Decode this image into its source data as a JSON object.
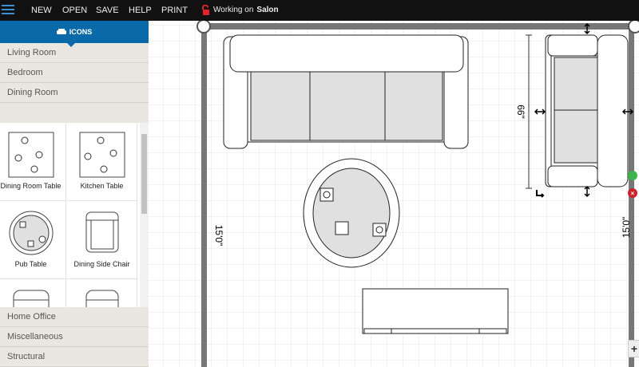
{
  "topbar": {
    "menu": [
      "NEW",
      "OPEN",
      "SAVE",
      "HELP",
      "PRINT"
    ],
    "working_prefix": "Working on",
    "project": "Salon"
  },
  "sidebar": {
    "tab_label": "ICONS",
    "categories_top": [
      "Living Room",
      "Bedroom",
      "Dining Room"
    ],
    "items": [
      "Dining Room Table",
      "Kitchen Table",
      "Pub Table",
      "Dining Side Chair",
      "",
      ""
    ],
    "categories_bottom": [
      "Home Office",
      "Miscellaneous",
      "Structural"
    ]
  },
  "canvas": {
    "wall_left_label": "15'0\"",
    "wall_right_label": "15'0\"",
    "sofa_dimension": "66\""
  },
  "colors": {
    "accent": "#0a6aa9",
    "topbar": "#111111",
    "wall": "#777777"
  }
}
